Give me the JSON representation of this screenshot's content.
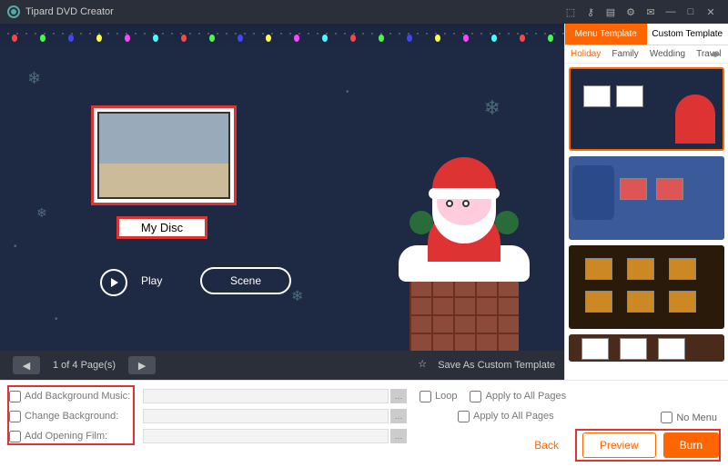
{
  "app": {
    "title": "Tipard DVD Creator"
  },
  "titlebar_icons": [
    "cart",
    "key",
    "page",
    "gear",
    "chat",
    "min",
    "max",
    "close"
  ],
  "preview": {
    "disc_title": "My Disc",
    "play_label": "Play",
    "scene_label": "Scene",
    "page_text": "1 of 4 Page(s)",
    "save_template": "Save As Custom Template"
  },
  "sidebar": {
    "tabs": [
      {
        "label": "Menu Template",
        "active": true
      },
      {
        "label": "Custom Template",
        "active": false
      }
    ],
    "categories": [
      "Holiday",
      "Family",
      "Wedding",
      "Travel"
    ],
    "active_category": "Holiday"
  },
  "options": {
    "bg_music": {
      "label": "Add Background Music:",
      "loop": "Loop",
      "apply_all": "Apply to All Pages"
    },
    "change_bg": {
      "label": "Change Background:",
      "apply_all": "Apply to All Pages"
    },
    "opening_film": {
      "label": "Add Opening Film:"
    },
    "no_menu": "No Menu"
  },
  "buttons": {
    "back": "Back",
    "preview": "Preview",
    "burn": "Burn"
  }
}
